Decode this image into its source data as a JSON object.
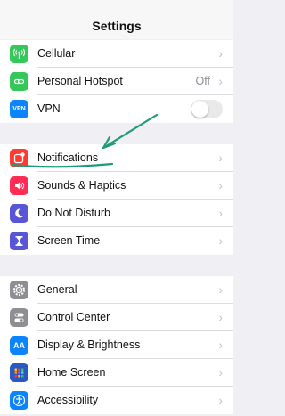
{
  "nav": {
    "title": "Settings"
  },
  "groups": [
    {
      "items": [
        {
          "label": "Cellular",
          "icon": "cellular-icon",
          "color": "#34c759"
        },
        {
          "label": "Personal Hotspot",
          "icon": "hotspot-icon",
          "color": "#34c759",
          "value": "Off"
        },
        {
          "label": "VPN",
          "icon": "vpn-icon",
          "color": "#0a84ff",
          "icon_text": "VPN",
          "toggle": false
        }
      ]
    },
    {
      "items": [
        {
          "label": "Notifications",
          "icon": "notifications-icon",
          "color": "#ff3b30"
        },
        {
          "label": "Sounds & Haptics",
          "icon": "speaker-icon",
          "color": "#ff2d55"
        },
        {
          "label": "Do Not Disturb",
          "icon": "moon-icon",
          "color": "#5856d6"
        },
        {
          "label": "Screen Time",
          "icon": "hourglass-icon",
          "color": "#5856d6"
        }
      ]
    },
    {
      "items": [
        {
          "label": "General",
          "icon": "gear-icon",
          "color": "#8e8e93"
        },
        {
          "label": "Control Center",
          "icon": "switches-icon",
          "color": "#8e8e93"
        },
        {
          "label": "Display & Brightness",
          "icon": "display-icon",
          "color": "#0a84ff",
          "icon_text": "AA"
        },
        {
          "label": "Home Screen",
          "icon": "home-screen-icon",
          "color": "#2b59c3"
        },
        {
          "label": "Accessibility",
          "icon": "accessibility-icon",
          "color": "#0a84ff"
        }
      ]
    }
  ],
  "annotation": {
    "color": "#1f9a7a"
  }
}
